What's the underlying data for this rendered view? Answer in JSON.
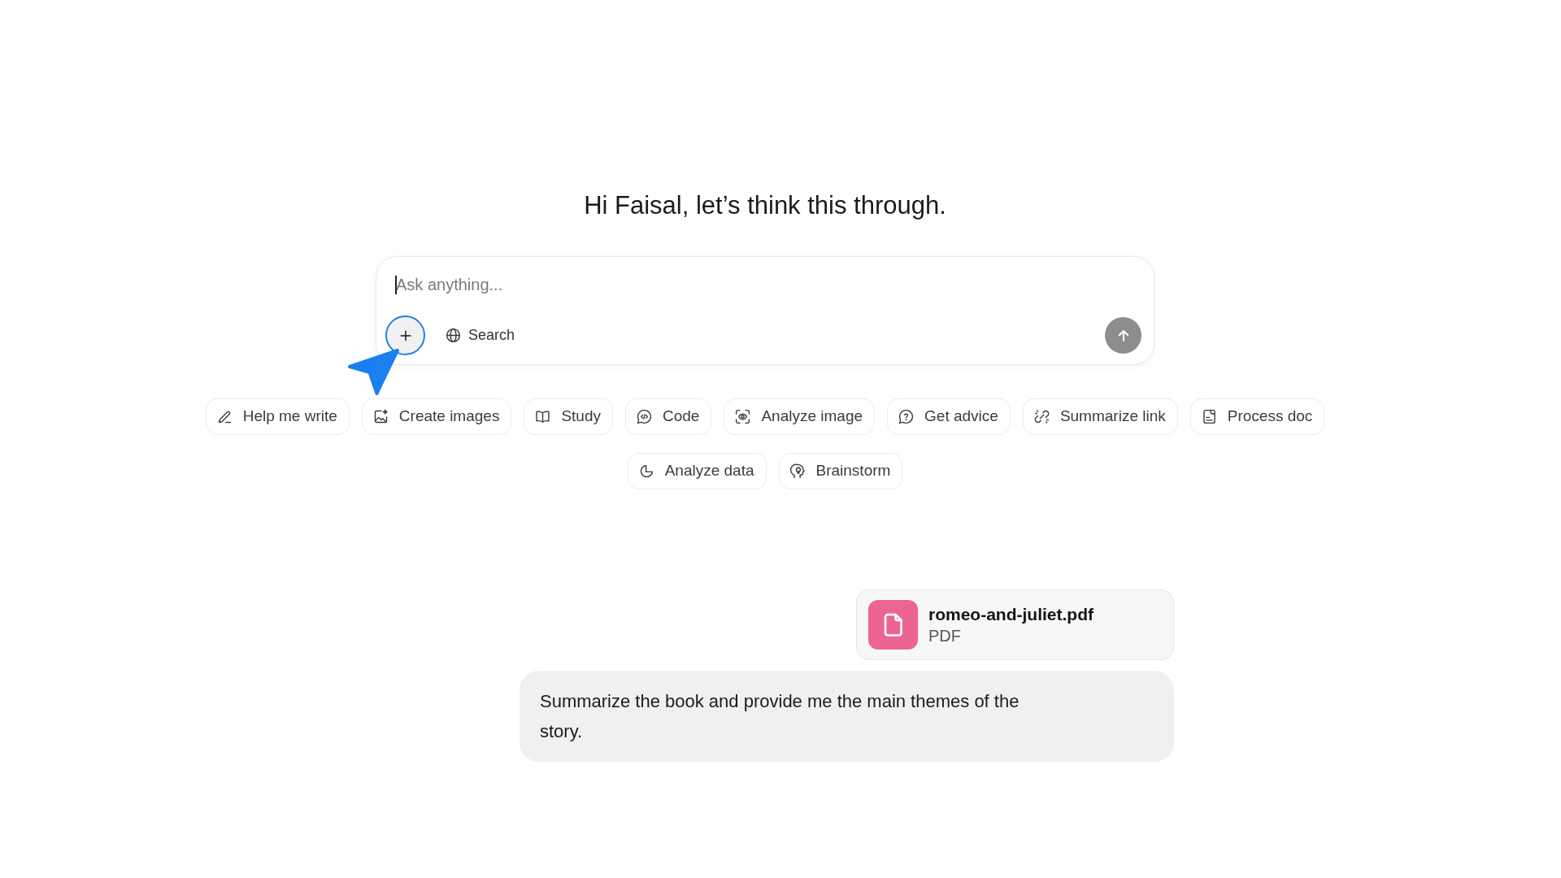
{
  "greeting": "Hi Faisal, let’s think this through.",
  "composer": {
    "input": {
      "placeholder": "Ask anything...",
      "focused": true
    },
    "attach_button": {
      "highlighted": true
    },
    "search_button": {
      "label": "Search"
    },
    "send_button": {
      "disabled": true
    }
  },
  "suggestion_rows": [
    [
      {
        "kind": "write",
        "label": "Help me write"
      },
      {
        "kind": "images",
        "label": "Create images"
      },
      {
        "kind": "study",
        "label": "Study"
      },
      {
        "kind": "code",
        "label": "Code"
      },
      {
        "kind": "vision",
        "label": "Analyze image"
      },
      {
        "kind": "advice",
        "label": "Get advice"
      },
      {
        "kind": "link",
        "label": "Summarize link"
      },
      {
        "kind": "document",
        "label": "Process doc"
      }
    ],
    [
      {
        "kind": "data",
        "label": "Analyze data"
      },
      {
        "kind": "brainstorm",
        "label": "Brainstorm"
      }
    ]
  ],
  "conversation": [
    {
      "kind": "attachment",
      "name": "romeo-and-juliet.pdf",
      "type": "PDF"
    },
    {
      "kind": "message",
      "text": "Summarize the book and provide me the main themes of the story."
    }
  ]
}
